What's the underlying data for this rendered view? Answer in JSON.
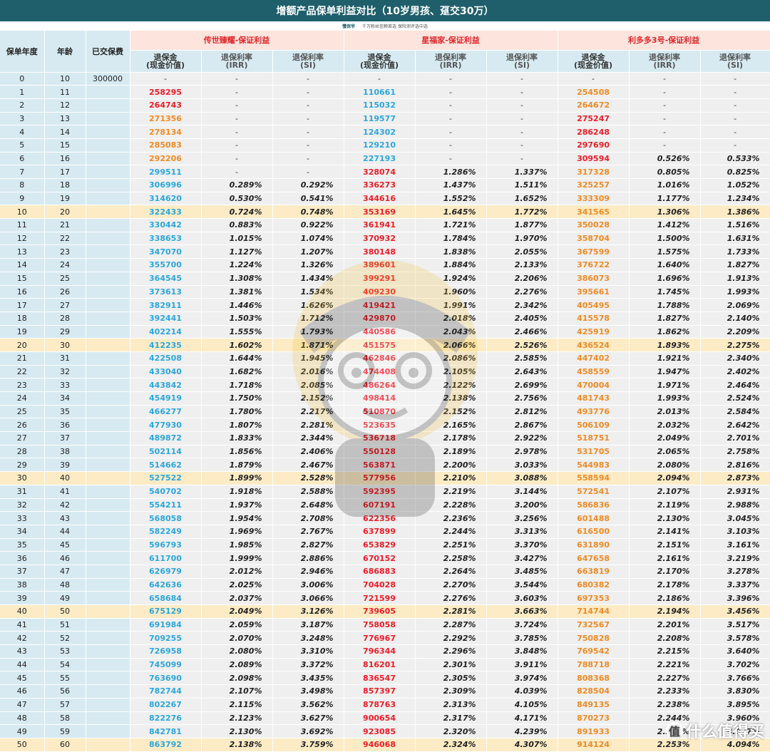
{
  "title": "增额产品保单利益对比（10岁男孩、趸交30万）",
  "subheader": {
    "brand": "懂保爷",
    "tagline": "千万粉丝信赖首选  保险测评选中选"
  },
  "columns": {
    "policy_year": "保单年度",
    "age": "年龄",
    "paid": "已交保费"
  },
  "products": [
    {
      "name": "传世臻耀-保证利益"
    },
    {
      "name": "星福家-保证利益"
    },
    {
      "name": "利多多3号-保证利益"
    }
  ],
  "subcols": {
    "cash_line1": "退保金",
    "cash_line2": "(现金价值)",
    "irr_line1": "退保利率",
    "irr_line2": "(IRR)",
    "si_line1": "退保利率",
    "si_line2": "(SI)"
  },
  "colors": {
    "blue": "#2aa7de",
    "red": "#ee1c24",
    "orange": "#f08a24",
    "header": "#1f5f6b",
    "highlight": "#fcebc4"
  },
  "watermark_icon": "cartoon-mascot-watermark",
  "corner_logo": {
    "icon": "smzdm-logo-icon",
    "glyph": "值",
    "text": "什么值得买"
  },
  "rows": [
    {
      "year": "0",
      "age": "10",
      "paid": "300000",
      "a": [
        "-",
        "-",
        "-"
      ],
      "ac": "",
      "b": [
        "-",
        "-",
        "-"
      ],
      "bc": "",
      "c": [
        "-",
        "-",
        "-"
      ],
      "cc": ""
    },
    {
      "year": "1",
      "age": "11",
      "paid": "",
      "a": [
        "258295",
        "-",
        "-"
      ],
      "ac": "red",
      "b": [
        "110661",
        "-",
        "-"
      ],
      "bc": "blue",
      "c": [
        "254508",
        "-",
        "-"
      ],
      "cc": "orange"
    },
    {
      "year": "2",
      "age": "12",
      "paid": "",
      "a": [
        "264743",
        "-",
        "-"
      ],
      "ac": "red",
      "b": [
        "115032",
        "-",
        "-"
      ],
      "bc": "blue",
      "c": [
        "264672",
        "-",
        "-"
      ],
      "cc": "orange"
    },
    {
      "year": "3",
      "age": "13",
      "paid": "",
      "a": [
        "271356",
        "-",
        "-"
      ],
      "ac": "orange",
      "b": [
        "119577",
        "-",
        "-"
      ],
      "bc": "blue",
      "c": [
        "275247",
        "-",
        "-"
      ],
      "cc": "red"
    },
    {
      "year": "4",
      "age": "14",
      "paid": "",
      "a": [
        "278134",
        "-",
        "-"
      ],
      "ac": "orange",
      "b": [
        "124302",
        "-",
        "-"
      ],
      "bc": "blue",
      "c": [
        "286248",
        "-",
        "-"
      ],
      "cc": "red"
    },
    {
      "year": "5",
      "age": "15",
      "paid": "",
      "a": [
        "285083",
        "-",
        "-"
      ],
      "ac": "orange",
      "b": [
        "129210",
        "-",
        "-"
      ],
      "bc": "blue",
      "c": [
        "297690",
        "-",
        "-"
      ],
      "cc": "red"
    },
    {
      "year": "6",
      "age": "16",
      "paid": "",
      "a": [
        "292206",
        "-",
        "-"
      ],
      "ac": "orange",
      "b": [
        "227193",
        "-",
        "-"
      ],
      "bc": "blue",
      "c": [
        "309594",
        "0.526%",
        "0.533%"
      ],
      "cc": "red"
    },
    {
      "year": "7",
      "age": "17",
      "paid": "",
      "a": [
        "299511",
        "-",
        "-"
      ],
      "ac": "blue",
      "b": [
        "328074",
        "1.286%",
        "1.337%"
      ],
      "bc": "red",
      "c": [
        "317328",
        "0.805%",
        "0.825%"
      ],
      "cc": "orange"
    },
    {
      "year": "8",
      "age": "18",
      "paid": "",
      "a": [
        "306996",
        "0.289%",
        "0.292%"
      ],
      "ac": "blue",
      "b": [
        "336273",
        "1.437%",
        "1.511%"
      ],
      "bc": "red",
      "c": [
        "325257",
        "1.016%",
        "1.052%"
      ],
      "cc": "orange"
    },
    {
      "year": "9",
      "age": "19",
      "paid": "",
      "a": [
        "314620",
        "0.530%",
        "0.541%"
      ],
      "ac": "blue",
      "b": [
        "344616",
        "1.552%",
        "1.652%"
      ],
      "bc": "red",
      "c": [
        "333309",
        "1.177%",
        "1.234%"
      ],
      "cc": "orange"
    },
    {
      "year": "10",
      "age": "20",
      "paid": "",
      "a": [
        "322433",
        "0.724%",
        "0.748%"
      ],
      "ac": "blue",
      "b": [
        "353169",
        "1.645%",
        "1.772%"
      ],
      "bc": "red",
      "c": [
        "341565",
        "1.306%",
        "1.386%"
      ],
      "cc": "orange",
      "hl": true
    },
    {
      "year": "11",
      "age": "21",
      "paid": "",
      "a": [
        "330442",
        "0.883%",
        "0.922%"
      ],
      "ac": "blue",
      "b": [
        "361941",
        "1.721%",
        "1.877%"
      ],
      "bc": "red",
      "c": [
        "350028",
        "1.412%",
        "1.516%"
      ],
      "cc": "orange"
    },
    {
      "year": "12",
      "age": "22",
      "paid": "",
      "a": [
        "338653",
        "1.015%",
        "1.074%"
      ],
      "ac": "blue",
      "b": [
        "370932",
        "1.784%",
        "1.970%"
      ],
      "bc": "red",
      "c": [
        "358704",
        "1.500%",
        "1.631%"
      ],
      "cc": "orange"
    },
    {
      "year": "13",
      "age": "23",
      "paid": "",
      "a": [
        "347070",
        "1.127%",
        "1.207%"
      ],
      "ac": "blue",
      "b": [
        "380148",
        "1.838%",
        "2.055%"
      ],
      "bc": "red",
      "c": [
        "367599",
        "1.575%",
        "1.733%"
      ],
      "cc": "orange"
    },
    {
      "year": "14",
      "age": "24",
      "paid": "",
      "a": [
        "355700",
        "1.224%",
        "1.326%"
      ],
      "ac": "blue",
      "b": [
        "389601",
        "1.884%",
        "2.133%"
      ],
      "bc": "red",
      "c": [
        "376722",
        "1.640%",
        "1.827%"
      ],
      "cc": "orange"
    },
    {
      "year": "15",
      "age": "25",
      "paid": "",
      "a": [
        "364545",
        "1.308%",
        "1.434%"
      ],
      "ac": "blue",
      "b": [
        "399291",
        "1.924%",
        "2.206%"
      ],
      "bc": "red",
      "c": [
        "386073",
        "1.696%",
        "1.913%"
      ],
      "cc": "orange"
    },
    {
      "year": "16",
      "age": "26",
      "paid": "",
      "a": [
        "373613",
        "1.381%",
        "1.534%"
      ],
      "ac": "blue",
      "b": [
        "409230",
        "1.960%",
        "2.276%"
      ],
      "bc": "red",
      "c": [
        "395661",
        "1.745%",
        "1.993%"
      ],
      "cc": "orange"
    },
    {
      "year": "17",
      "age": "27",
      "paid": "",
      "a": [
        "382911",
        "1.446%",
        "1.626%"
      ],
      "ac": "blue",
      "b": [
        "419421",
        "1.991%",
        "2.342%"
      ],
      "bc": "red",
      "c": [
        "405495",
        "1.788%",
        "2.069%"
      ],
      "cc": "orange"
    },
    {
      "year": "18",
      "age": "28",
      "paid": "",
      "a": [
        "392441",
        "1.503%",
        "1.712%"
      ],
      "ac": "blue",
      "b": [
        "429870",
        "2.018%",
        "2.405%"
      ],
      "bc": "red",
      "c": [
        "415578",
        "1.827%",
        "2.140%"
      ],
      "cc": "orange"
    },
    {
      "year": "19",
      "age": "29",
      "paid": "",
      "a": [
        "402214",
        "1.555%",
        "1.793%"
      ],
      "ac": "blue",
      "b": [
        "440586",
        "2.043%",
        "2.466%"
      ],
      "bc": "red",
      "c": [
        "425919",
        "1.862%",
        "2.209%"
      ],
      "cc": "orange"
    },
    {
      "year": "20",
      "age": "30",
      "paid": "",
      "a": [
        "412235",
        "1.602%",
        "1.871%"
      ],
      "ac": "blue",
      "b": [
        "451575",
        "2.066%",
        "2.526%"
      ],
      "bc": "red",
      "c": [
        "436524",
        "1.893%",
        "2.275%"
      ],
      "cc": "orange",
      "hl": true
    },
    {
      "year": "21",
      "age": "31",
      "paid": "",
      "a": [
        "422508",
        "1.644%",
        "1.945%"
      ],
      "ac": "blue",
      "b": [
        "462846",
        "2.086%",
        "2.585%"
      ],
      "bc": "red",
      "c": [
        "447402",
        "1.921%",
        "2.340%"
      ],
      "cc": "orange"
    },
    {
      "year": "22",
      "age": "32",
      "paid": "",
      "a": [
        "433040",
        "1.682%",
        "2.016%"
      ],
      "ac": "blue",
      "b": [
        "474408",
        "2.105%",
        "2.643%"
      ],
      "bc": "red",
      "c": [
        "458559",
        "1.947%",
        "2.402%"
      ],
      "cc": "orange"
    },
    {
      "year": "23",
      "age": "33",
      "paid": "",
      "a": [
        "443842",
        "1.718%",
        "2.085%"
      ],
      "ac": "blue",
      "b": [
        "486264",
        "2.122%",
        "2.699%"
      ],
      "bc": "red",
      "c": [
        "470004",
        "1.971%",
        "2.464%"
      ],
      "cc": "orange"
    },
    {
      "year": "24",
      "age": "34",
      "paid": "",
      "a": [
        "454919",
        "1.750%",
        "2.152%"
      ],
      "ac": "blue",
      "b": [
        "498414",
        "2.138%",
        "2.756%"
      ],
      "bc": "red",
      "c": [
        "481743",
        "1.993%",
        "2.524%"
      ],
      "cc": "orange"
    },
    {
      "year": "25",
      "age": "35",
      "paid": "",
      "a": [
        "466277",
        "1.780%",
        "2.217%"
      ],
      "ac": "blue",
      "b": [
        "510870",
        "2.152%",
        "2.812%"
      ],
      "bc": "red",
      "c": [
        "493776",
        "2.013%",
        "2.584%"
      ],
      "cc": "orange"
    },
    {
      "year": "26",
      "age": "36",
      "paid": "",
      "a": [
        "477930",
        "1.807%",
        "2.281%"
      ],
      "ac": "blue",
      "b": [
        "523635",
        "2.165%",
        "2.867%"
      ],
      "bc": "red",
      "c": [
        "506109",
        "2.032%",
        "2.642%"
      ],
      "cc": "orange"
    },
    {
      "year": "27",
      "age": "37",
      "paid": "",
      "a": [
        "489872",
        "1.833%",
        "2.344%"
      ],
      "ac": "blue",
      "b": [
        "536718",
        "2.178%",
        "2.922%"
      ],
      "bc": "red",
      "c": [
        "518751",
        "2.049%",
        "2.701%"
      ],
      "cc": "orange"
    },
    {
      "year": "28",
      "age": "38",
      "paid": "",
      "a": [
        "502114",
        "1.856%",
        "2.406%"
      ],
      "ac": "blue",
      "b": [
        "550128",
        "2.189%",
        "2.978%"
      ],
      "bc": "red",
      "c": [
        "531705",
        "2.065%",
        "2.758%"
      ],
      "cc": "orange"
    },
    {
      "year": "29",
      "age": "39",
      "paid": "",
      "a": [
        "514662",
        "1.879%",
        "2.467%"
      ],
      "ac": "blue",
      "b": [
        "563871",
        "2.200%",
        "3.033%"
      ],
      "bc": "red",
      "c": [
        "544983",
        "2.080%",
        "2.816%"
      ],
      "cc": "orange"
    },
    {
      "year": "30",
      "age": "40",
      "paid": "",
      "a": [
        "527522",
        "1.899%",
        "2.528%"
      ],
      "ac": "blue",
      "b": [
        "577956",
        "2.210%",
        "3.088%"
      ],
      "bc": "red",
      "c": [
        "558594",
        "2.094%",
        "2.873%"
      ],
      "cc": "orange",
      "hl": true
    },
    {
      "year": "31",
      "age": "41",
      "paid": "",
      "a": [
        "540702",
        "1.918%",
        "2.588%"
      ],
      "ac": "blue",
      "b": [
        "592395",
        "2.219%",
        "3.144%"
      ],
      "bc": "red",
      "c": [
        "572541",
        "2.107%",
        "2.931%"
      ],
      "cc": "orange"
    },
    {
      "year": "32",
      "age": "42",
      "paid": "",
      "a": [
        "554211",
        "1.937%",
        "2.648%"
      ],
      "ac": "blue",
      "b": [
        "607191",
        "2.228%",
        "3.200%"
      ],
      "bc": "red",
      "c": [
        "586836",
        "2.119%",
        "2.988%"
      ],
      "cc": "orange"
    },
    {
      "year": "33",
      "age": "43",
      "paid": "",
      "a": [
        "568058",
        "1.954%",
        "2.708%"
      ],
      "ac": "blue",
      "b": [
        "622356",
        "2.236%",
        "3.256%"
      ],
      "bc": "red",
      "c": [
        "601488",
        "2.130%",
        "3.045%"
      ],
      "cc": "orange"
    },
    {
      "year": "34",
      "age": "44",
      "paid": "",
      "a": [
        "582249",
        "1.969%",
        "2.767%"
      ],
      "ac": "blue",
      "b": [
        "637899",
        "2.244%",
        "3.313%"
      ],
      "bc": "red",
      "c": [
        "616500",
        "2.141%",
        "3.103%"
      ],
      "cc": "orange"
    },
    {
      "year": "35",
      "age": "45",
      "paid": "",
      "a": [
        "596793",
        "1.985%",
        "2.827%"
      ],
      "ac": "blue",
      "b": [
        "653829",
        "2.251%",
        "3.370%"
      ],
      "bc": "red",
      "c": [
        "631890",
        "2.151%",
        "3.161%"
      ],
      "cc": "orange"
    },
    {
      "year": "36",
      "age": "46",
      "paid": "",
      "a": [
        "611700",
        "1.999%",
        "2.886%"
      ],
      "ac": "blue",
      "b": [
        "670152",
        "2.258%",
        "3.427%"
      ],
      "bc": "red",
      "c": [
        "647658",
        "2.161%",
        "3.219%"
      ],
      "cc": "orange"
    },
    {
      "year": "37",
      "age": "47",
      "paid": "",
      "a": [
        "626979",
        "2.012%",
        "2.946%"
      ],
      "ac": "blue",
      "b": [
        "686883",
        "2.264%",
        "3.485%"
      ],
      "bc": "red",
      "c": [
        "663819",
        "2.170%",
        "3.278%"
      ],
      "cc": "orange"
    },
    {
      "year": "38",
      "age": "48",
      "paid": "",
      "a": [
        "642636",
        "2.025%",
        "3.006%"
      ],
      "ac": "blue",
      "b": [
        "704028",
        "2.270%",
        "3.544%"
      ],
      "bc": "red",
      "c": [
        "680382",
        "2.178%",
        "3.337%"
      ],
      "cc": "orange"
    },
    {
      "year": "39",
      "age": "49",
      "paid": "",
      "a": [
        "658684",
        "2.037%",
        "3.066%"
      ],
      "ac": "blue",
      "b": [
        "721599",
        "2.276%",
        "3.603%"
      ],
      "bc": "red",
      "c": [
        "697353",
        "2.186%",
        "3.396%"
      ],
      "cc": "orange"
    },
    {
      "year": "40",
      "age": "50",
      "paid": "",
      "a": [
        "675129",
        "2.049%",
        "3.126%"
      ],
      "ac": "blue",
      "b": [
        "739605",
        "2.281%",
        "3.663%"
      ],
      "bc": "red",
      "c": [
        "714744",
        "2.194%",
        "3.456%"
      ],
      "cc": "orange",
      "hl": true
    },
    {
      "year": "41",
      "age": "51",
      "paid": "",
      "a": [
        "691984",
        "2.059%",
        "3.187%"
      ],
      "ac": "blue",
      "b": [
        "758058",
        "2.287%",
        "3.724%"
      ],
      "bc": "red",
      "c": [
        "732567",
        "2.201%",
        "3.517%"
      ],
      "cc": "orange"
    },
    {
      "year": "42",
      "age": "52",
      "paid": "",
      "a": [
        "709255",
        "2.070%",
        "3.248%"
      ],
      "ac": "blue",
      "b": [
        "776967",
        "2.292%",
        "3.785%"
      ],
      "bc": "red",
      "c": [
        "750828",
        "2.208%",
        "3.578%"
      ],
      "cc": "orange"
    },
    {
      "year": "43",
      "age": "53",
      "paid": "",
      "a": [
        "726958",
        "2.080%",
        "3.310%"
      ],
      "ac": "blue",
      "b": [
        "796344",
        "2.296%",
        "3.848%"
      ],
      "bc": "red",
      "c": [
        "769542",
        "2.215%",
        "3.640%"
      ],
      "cc": "orange"
    },
    {
      "year": "44",
      "age": "54",
      "paid": "",
      "a": [
        "745099",
        "2.089%",
        "3.372%"
      ],
      "ac": "blue",
      "b": [
        "816201",
        "2.301%",
        "3.911%"
      ],
      "bc": "red",
      "c": [
        "788718",
        "2.221%",
        "3.702%"
      ],
      "cc": "orange"
    },
    {
      "year": "45",
      "age": "55",
      "paid": "",
      "a": [
        "763690",
        "2.098%",
        "3.435%"
      ],
      "ac": "blue",
      "b": [
        "836547",
        "2.305%",
        "3.974%"
      ],
      "bc": "red",
      "c": [
        "808368",
        "2.227%",
        "3.766%"
      ],
      "cc": "orange"
    },
    {
      "year": "46",
      "age": "56",
      "paid": "",
      "a": [
        "782744",
        "2.107%",
        "3.498%"
      ],
      "ac": "blue",
      "b": [
        "857397",
        "2.309%",
        "4.039%"
      ],
      "bc": "red",
      "c": [
        "828504",
        "2.233%",
        "3.830%"
      ],
      "cc": "orange"
    },
    {
      "year": "47",
      "age": "57",
      "paid": "",
      "a": [
        "802267",
        "2.115%",
        "3.562%"
      ],
      "ac": "blue",
      "b": [
        "878763",
        "2.313%",
        "4.105%"
      ],
      "bc": "red",
      "c": [
        "849135",
        "2.238%",
        "3.895%"
      ],
      "cc": "orange"
    },
    {
      "year": "48",
      "age": "58",
      "paid": "",
      "a": [
        "822276",
        "2.123%",
        "3.627%"
      ],
      "ac": "blue",
      "b": [
        "900654",
        "2.317%",
        "4.171%"
      ],
      "bc": "red",
      "c": [
        "870273",
        "2.244%",
        "3.960%"
      ],
      "cc": "orange"
    },
    {
      "year": "49",
      "age": "59",
      "paid": "",
      "a": [
        "842781",
        "2.130%",
        "3.692%"
      ],
      "ac": "blue",
      "b": [
        "923085",
        "2.320%",
        "4.239%"
      ],
      "bc": "red",
      "c": [
        "891933",
        "2.249%",
        "4.027%"
      ],
      "cc": "orange"
    },
    {
      "year": "50",
      "age": "60",
      "paid": "",
      "a": [
        "863792",
        "2.138%",
        "3.759%"
      ],
      "ac": "blue",
      "b": [
        "946068",
        "2.324%",
        "4.307%"
      ],
      "bc": "red",
      "c": [
        "914124",
        "2.253%",
        "4.094%"
      ],
      "cc": "orange",
      "hl": true
    }
  ]
}
